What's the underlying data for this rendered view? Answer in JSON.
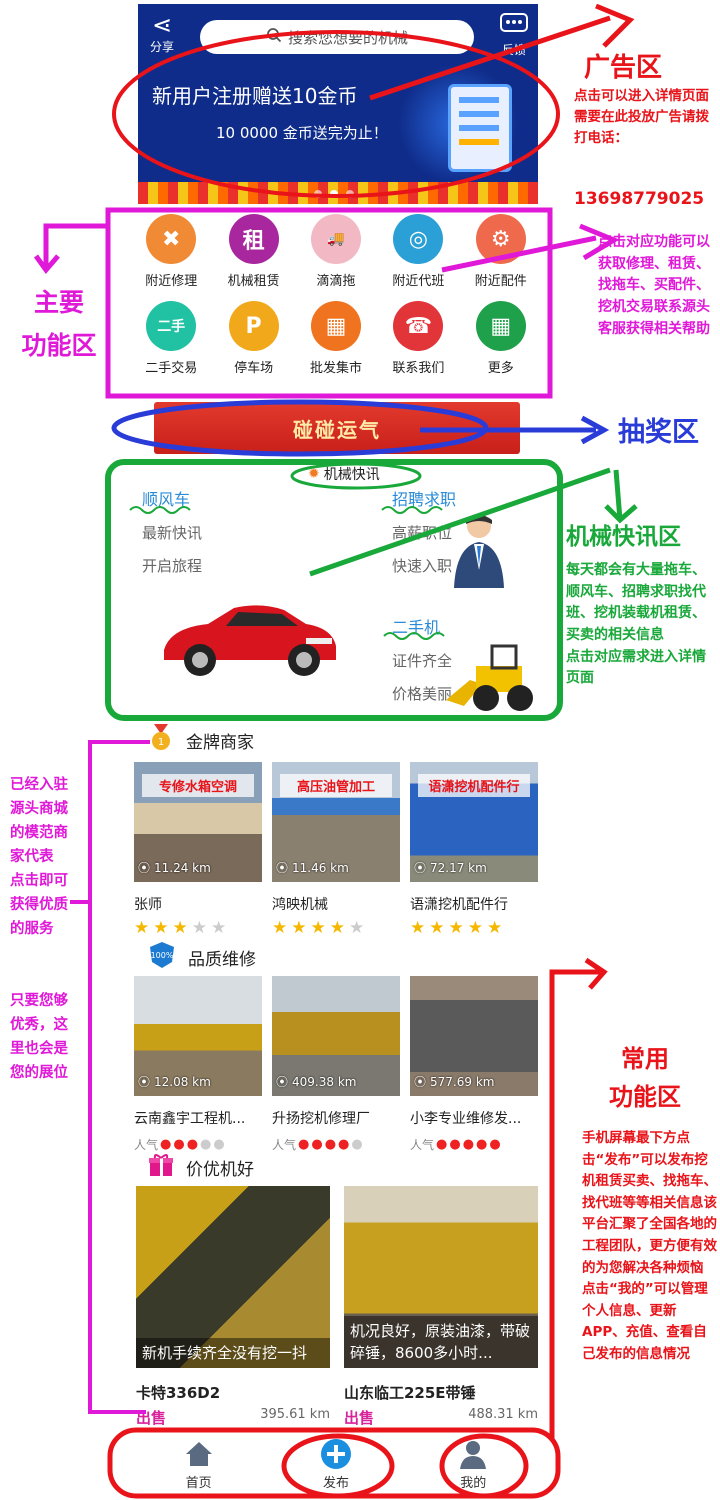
{
  "banner": {
    "share_label": "分享",
    "feedback_label": "反馈",
    "search_placeholder": "搜索您想要的机械",
    "promo_title": "新用户注册赠送10金币",
    "promo_sub": "10 0000 金币送完为止！"
  },
  "functions": [
    {
      "label": "附近修理",
      "icon": "wrench-icon",
      "color": "#f08a35",
      "glyph": "✖"
    },
    {
      "label": "机械租赁",
      "icon": "rent-shield-icon",
      "color": "#a8269e",
      "glyph": "租"
    },
    {
      "label": "滴滴拖",
      "icon": "tow-truck-icon",
      "color": "#f2b9c4",
      "glyph": "🚚"
    },
    {
      "label": "附近代班",
      "icon": "steering-wheel-icon",
      "color": "#2aa0d6",
      "glyph": "◎"
    },
    {
      "label": "附近配件",
      "icon": "piston-icon",
      "color": "#ef6a4c",
      "glyph": "⚙"
    },
    {
      "label": "二手交易",
      "icon": "handshake-icon",
      "color": "#21c2a4",
      "glyph": "二手"
    },
    {
      "label": "停车场",
      "icon": "parking-icon",
      "color": "#f2a81b",
      "glyph": "P"
    },
    {
      "label": "批发集市",
      "icon": "market-stall-icon",
      "color": "#f0731f",
      "glyph": "▦"
    },
    {
      "label": "联系我们",
      "icon": "contact-people-icon",
      "color": "#e2353a",
      "glyph": "☎"
    },
    {
      "label": "更多",
      "icon": "grid-more-icon",
      "color": "#1fa04a",
      "glyph": "▦"
    }
  ],
  "lottery_label": "碰碰运气",
  "news": {
    "header": "机械快讯",
    "ride": {
      "title": "顺风车",
      "line1": "最新快讯",
      "line2": "开启旅程"
    },
    "jobs": {
      "title": "招聘求职",
      "line1": "高薪职位",
      "line2": "快速入职"
    },
    "used": {
      "title": "二手机",
      "line1": "证件齐全",
      "line2": "价格美丽"
    }
  },
  "gold": {
    "title": "金牌商家",
    "items": [
      {
        "name": "张师",
        "dist": "11.24 km",
        "stars": 3,
        "sign": "专修水箱空调"
      },
      {
        "name": "鸿映机械",
        "dist": "11.46 km",
        "stars": 4,
        "sign": "高压油管加工"
      },
      {
        "name": "语潇挖机配件行",
        "dist": "72.17 km",
        "stars": 5,
        "sign": "语潇挖机配件行"
      }
    ]
  },
  "quality": {
    "title": "品质维修",
    "popularity_label": "人气",
    "items": [
      {
        "name": "云南鑫宇工程机...",
        "dist": "12.08 km",
        "heat": 3
      },
      {
        "name": "升扬挖机修理厂",
        "dist": "409.38 km",
        "heat": 4
      },
      {
        "name": "小李专业维修发...",
        "dist": "577.69 km",
        "heat": 5
      }
    ]
  },
  "deals": {
    "title": "价优机好",
    "items": [
      {
        "caption": "新机手续齐全没有挖一抖",
        "name": "卡特336D2",
        "tag": "出售",
        "dist": "395.61 km"
      },
      {
        "caption": "机况良好，原装油漆，带破碎锤，8600多小时...",
        "name": "山东临工225E带锤",
        "tag": "出售",
        "dist": "488.31 km"
      }
    ]
  },
  "nav": {
    "home": "首页",
    "publish": "发布",
    "mine": "我的"
  },
  "annotations": {
    "ad_title": "广告区",
    "ad_body": "点击可以进入详情页面\n需要在此投放广告请拨打电话：",
    "ad_phone": "13698779025",
    "main_title": "主要\n功能区",
    "main_body": "点击对应功能可以获取修理、租赁、找拖车、买配件、挖机交易联系源头客服获得相关帮助",
    "lottery_title": "抽奖区",
    "news_title": "机械快讯区",
    "news_body": "每天都会有大量拖车、顺风车、招聘求职找代班、挖机装载机租赁、买卖的相关信息\n点击对应需求进入详情页面",
    "merchant_body": "已经入驻源头商城的模范商家代表\n点击即可获得优质的服务",
    "merchant_body2": "只要您够优秀，这里也会是您的展位",
    "common_title": "常用\n功能区",
    "common_body": "手机屏幕最下方点击“发布”可以发布挖机租赁买卖、找拖车、找代班等等相关信息该平台汇聚了全国各地的工程团队，更方便有效的为您解决各种烦恼\n点击“我的”可以管理个人信息、更新APP、充值、查看自己发布的信息情况"
  }
}
